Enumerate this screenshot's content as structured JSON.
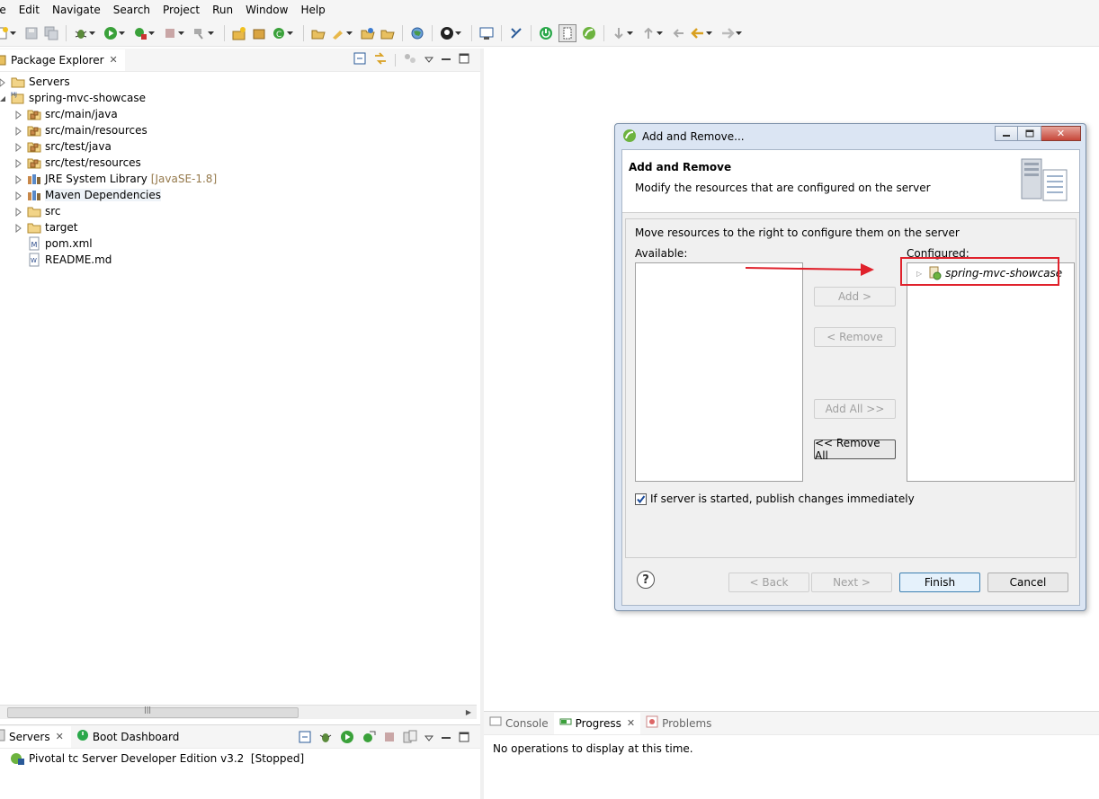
{
  "menu": [
    "le",
    "Edit",
    "Navigate",
    "Search",
    "Project",
    "Run",
    "Window",
    "Help"
  ],
  "package_explorer": {
    "title": "Package Explorer",
    "tree": [
      {
        "label": "Servers",
        "decoration": "",
        "indent": 0,
        "icon": "folder-icon",
        "twisty": "collapsed"
      },
      {
        "label": "spring-mvc-showcase",
        "decoration": "",
        "indent": 0,
        "icon": "maven-project-icon",
        "twisty": "expanded"
      },
      {
        "label": "src/main/java",
        "decoration": "",
        "indent": 1,
        "icon": "source-folder-icon",
        "twisty": "collapsed"
      },
      {
        "label": "src/main/resources",
        "decoration": "",
        "indent": 1,
        "icon": "source-folder-icon",
        "twisty": "collapsed"
      },
      {
        "label": "src/test/java",
        "decoration": "",
        "indent": 1,
        "icon": "source-folder-icon",
        "twisty": "collapsed"
      },
      {
        "label": "src/test/resources",
        "decoration": "",
        "indent": 1,
        "icon": "source-folder-icon",
        "twisty": "collapsed"
      },
      {
        "label": "JRE System Library",
        "decoration": "[JavaSE-1.8]",
        "indent": 1,
        "icon": "library-icon",
        "twisty": "collapsed"
      },
      {
        "label": "Maven Dependencies",
        "decoration": "",
        "indent": 1,
        "icon": "library-icon",
        "twisty": "collapsed"
      },
      {
        "label": "src",
        "decoration": "",
        "indent": 1,
        "icon": "folder-icon",
        "twisty": "collapsed"
      },
      {
        "label": "target",
        "decoration": "",
        "indent": 1,
        "icon": "folder-icon",
        "twisty": "collapsed"
      },
      {
        "label": "pom.xml",
        "decoration": "",
        "indent": 1,
        "icon": "maven-file-icon",
        "twisty": "none"
      },
      {
        "label": "README.md",
        "decoration": "",
        "indent": 1,
        "icon": "text-file-icon",
        "twisty": "none"
      }
    ]
  },
  "servers_panel": {
    "tab_servers": "Servers",
    "tab_boot_dashboard": "Boot Dashboard",
    "server_entry": "Pivotal tc Server Developer Edition v3.2  [Stopped]"
  },
  "bottom_right": {
    "tab_console": "Console",
    "tab_progress": "Progress",
    "tab_problems": "Problems",
    "message": "No operations to display at this time."
  },
  "dialog": {
    "window_title": "Add and Remove...",
    "header_title": "Add and Remove",
    "header_subtitle": "Modify the resources that are configured on the server",
    "instruction": "Move resources to the right to configure them on the server",
    "available_label": "Available:",
    "configured_label": "Configured:",
    "configured_items": [
      "spring-mvc-showcase"
    ],
    "add_button": "Add >",
    "remove_button": "< Remove",
    "add_all_button": "Add All >>",
    "remove_all_button": "<< Remove All",
    "publish_checkbox": "If server is started, publish changes immediately",
    "publish_checked": true,
    "back_button": "< Back",
    "next_button": "Next >",
    "finish_button": "Finish",
    "cancel_button": "Cancel",
    "help_icon": "?"
  },
  "colors": {
    "highlight_annotation": "#e0222c",
    "decoration_text": "#95794b",
    "dialog_frame": "#dbe5f3"
  }
}
